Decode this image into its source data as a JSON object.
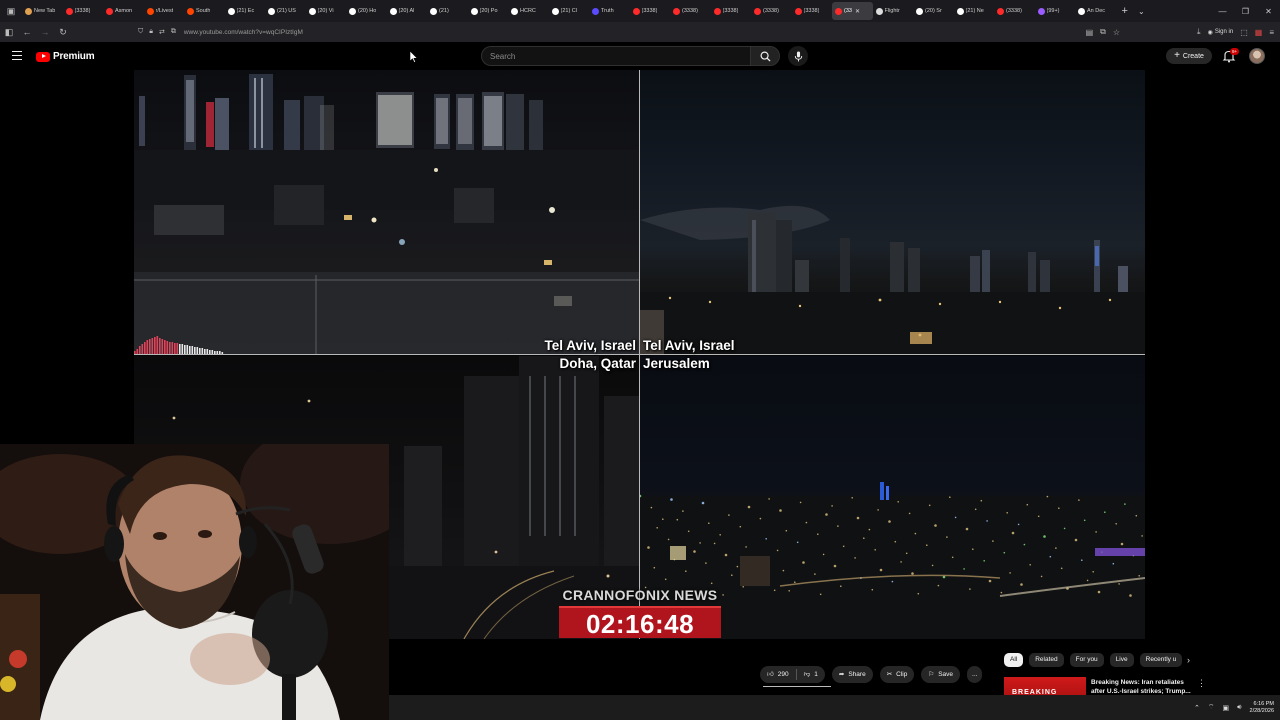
{
  "browser": {
    "tabs": [
      {
        "label": "New Tab",
        "color": "#e0a050"
      },
      {
        "label": "(3338)",
        "color": "#ff2a2a"
      },
      {
        "label": "Asmon",
        "color": "#ff2a2a"
      },
      {
        "label": "r/Livest",
        "color": "#ff4500"
      },
      {
        "label": "South",
        "color": "#ff4500"
      },
      {
        "label": "(21) Ec",
        "color": "#ffffff"
      },
      {
        "label": "(21) US",
        "color": "#ffffff"
      },
      {
        "label": "(20) Vi",
        "color": "#ffffff"
      },
      {
        "label": "(20) Ho",
        "color": "#ffffff"
      },
      {
        "label": "(20) Al",
        "color": "#ffffff"
      },
      {
        "label": "(21)",
        "color": "#ffffff"
      },
      {
        "label": "(20) Po",
        "color": "#ffffff"
      },
      {
        "label": "HCRC",
        "color": "#ffffff"
      },
      {
        "label": "(21) Cl",
        "color": "#ffffff"
      },
      {
        "label": "Truth",
        "color": "#5a4bff"
      },
      {
        "label": "(3338)",
        "color": "#ff2a2a"
      },
      {
        "label": "(3338)",
        "color": "#ff2a2a"
      },
      {
        "label": "(3338)",
        "color": "#ff2a2a"
      },
      {
        "label": "(3338)",
        "color": "#ff2a2a"
      },
      {
        "label": "(3338)",
        "color": "#ff2a2a"
      },
      {
        "label": "(33",
        "color": "#ff2a2a",
        "active": true
      },
      {
        "label": "Flightr",
        "color": "#dddddd"
      },
      {
        "label": "(20) Sr",
        "color": "#ffffff"
      },
      {
        "label": "(21) Ne",
        "color": "#ffffff"
      },
      {
        "label": "(3338)",
        "color": "#ff2a2a"
      },
      {
        "label": "(99+)",
        "color": "#9b5cff"
      },
      {
        "label": "An Dec",
        "color": "#ffffff"
      }
    ],
    "new_tab": "+",
    "url": "www.youtube.com/watch?v=wqCIPIztIgM",
    "signin_label": "Sign in"
  },
  "youtube": {
    "logo_text": "Premium",
    "search_placeholder": "Search",
    "create_label": "Create",
    "notification_badge": "9+",
    "brand_color": "#ff0000"
  },
  "video": {
    "labels": {
      "top_left": "Tel Aviv, Israel",
      "bottom_left": "Doha, Qatar",
      "top_right": "Tel Aviv, Israel",
      "bottom_right": "Jerusalem"
    },
    "news_label": "CRANNOFONIX NEWS",
    "clock": "02:16:48",
    "clock_color": "#b0151d"
  },
  "actions": {
    "likes": "290",
    "dislikes": "1",
    "share": "Share",
    "clip": "Clip",
    "save": "Save",
    "more": "..."
  },
  "chips": [
    "All",
    "Related",
    "For you",
    "Live",
    "Recently u"
  ],
  "related": {
    "title": "Breaking News: Iran retaliates after U.S.-Israel strikes; Trump...",
    "thumb_text": "BREAKING"
  },
  "taskbar": {
    "time": "6:16 PM",
    "date": "2/28/2026"
  }
}
